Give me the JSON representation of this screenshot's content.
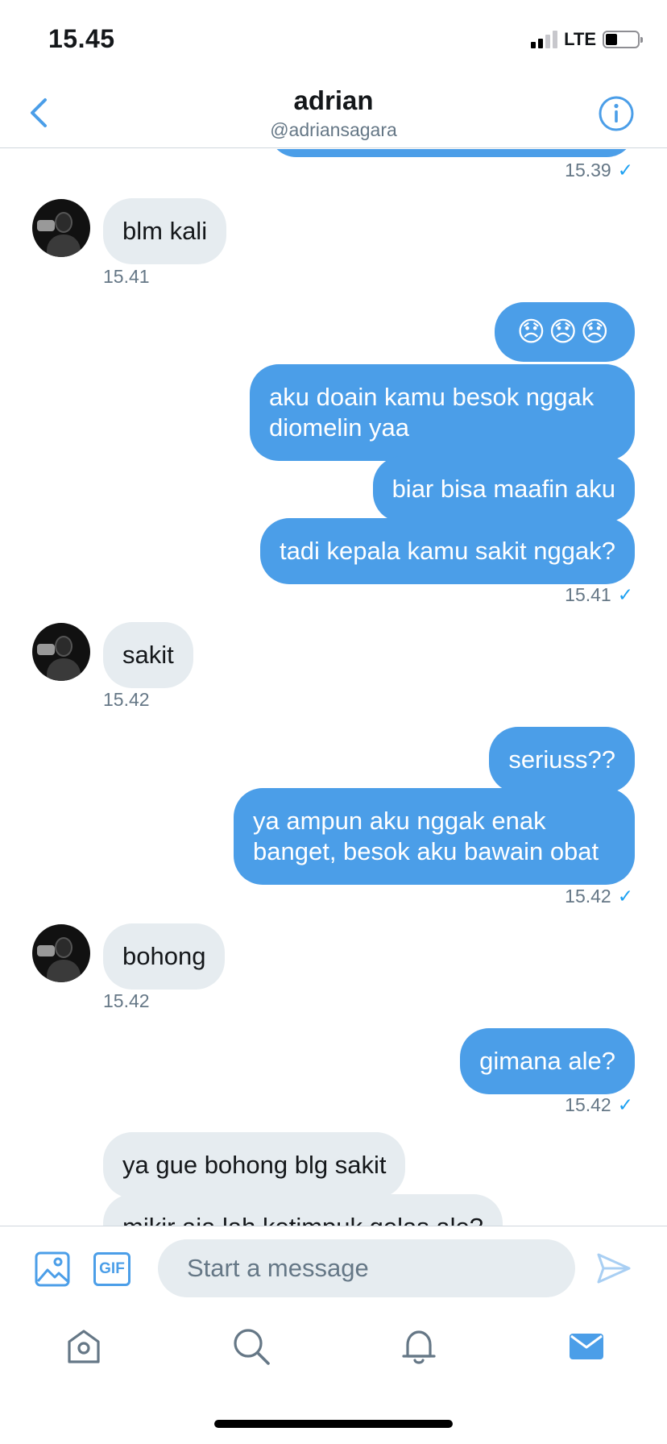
{
  "status_bar": {
    "time": "15.45",
    "network": "LTE"
  },
  "header": {
    "title": "adrian",
    "handle": "@adriansagara"
  },
  "messages": [
    {
      "text": "",
      "time": "15.39"
    },
    {
      "text": "blm kali",
      "time": "15.41"
    },
    {
      "text": "😞😞😞"
    },
    {
      "text": "aku doain kamu besok nggak diomelin yaa"
    },
    {
      "text": "biar bisa maafin aku"
    },
    {
      "text": "tadi kepala kamu sakit nggak?",
      "time": "15.41"
    },
    {
      "text": "sakit",
      "time": "15.42"
    },
    {
      "text": "seriuss??"
    },
    {
      "text": "ya ampun aku nggak enak banget, besok aku bawain obat",
      "time": "15.42"
    },
    {
      "text": "bohong",
      "time": "15.42"
    },
    {
      "text": "gimana ale?",
      "time": "15.42"
    },
    {
      "text": "ya gue bohong blg sakit"
    },
    {
      "text": "mikir aja lah ketimpuk gelas ale?"
    }
  ],
  "read_mark": "✓",
  "composer": {
    "placeholder": "Start a message",
    "gif_label": "GIF"
  },
  "colors": {
    "accent": "#4b9ee8",
    "incoming_bubble": "#e6ecf0",
    "secondary_text": "#657786"
  },
  "icons": {
    "back": "chevron-left-icon",
    "info": "info-icon",
    "media": "image-icon",
    "gif": "gif-icon",
    "send": "send-icon",
    "tabs": [
      "home-icon",
      "search-icon",
      "bell-icon",
      "mail-icon"
    ]
  }
}
